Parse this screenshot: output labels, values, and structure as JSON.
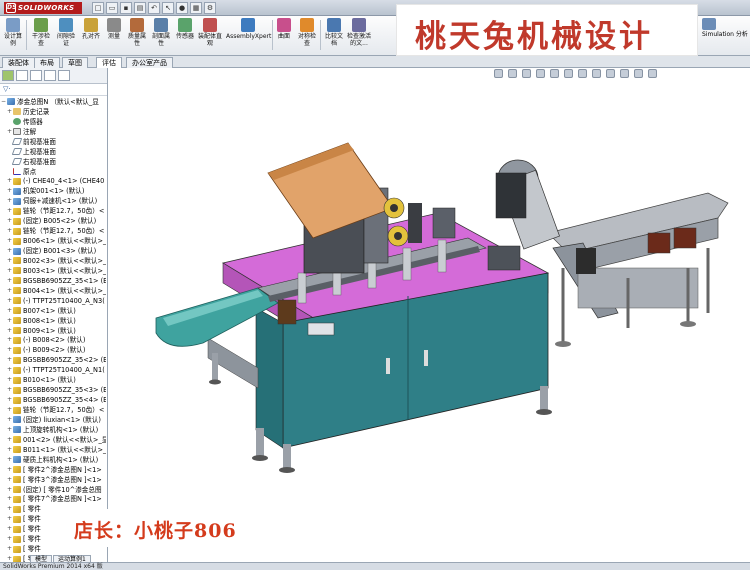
{
  "app": {
    "logo_text": "SOLIDWORKS",
    "status_text": "SolidWorks Premium 2014 x64 版"
  },
  "ribbon": {
    "buttons": [
      {
        "label": "设计算例",
        "color": "#7a9cc6"
      },
      {
        "label": "干涉检查",
        "color": "#6b9e4b"
      },
      {
        "label": "间隙验证",
        "color": "#4e8fbf"
      },
      {
        "label": "孔对齐",
        "color": "#c9a23a"
      },
      {
        "label": "测量",
        "color": "#8a8a8a"
      },
      {
        "label": "质量属性",
        "color": "#b36a3b"
      },
      {
        "label": "剖面属性",
        "color": "#5a7fa8"
      },
      {
        "label": "传感器",
        "color": "#5aa36b"
      },
      {
        "label": "装配体直观",
        "color": "#c05050"
      },
      {
        "label": "AssemblyXpert",
        "color": "#3d7bbf"
      },
      {
        "label": "曲面",
        "color": "#c84f8c"
      },
      {
        "label": "对称检查",
        "color": "#e08a2b"
      },
      {
        "label": "比较文档",
        "color": "#4a78b0"
      },
      {
        "label": "检查激活的文...",
        "color": "#6b6b9e"
      },
      {
        "label": "Simulation 分析",
        "color": "#6c8db7"
      }
    ]
  },
  "watermarks": {
    "top": "桃天兔机械设计",
    "bottom": "店长：小桃子806"
  },
  "tabs": [
    "装配体",
    "布局",
    "草图",
    "评估",
    "办公室产品"
  ],
  "tree": {
    "filter_icon": "filter-icon",
    "items": [
      {
        "label": "渗金总图N （默认<默认_显",
        "icon": "asm",
        "exp": "−"
      },
      {
        "label": "历史记录",
        "icon": "folder",
        "exp": "+"
      },
      {
        "label": "传感器",
        "icon": "sensor",
        "exp": ""
      },
      {
        "label": "注解",
        "icon": "note",
        "exp": "+"
      },
      {
        "label": "前视基准面",
        "icon": "plane",
        "exp": ""
      },
      {
        "label": "上视基准面",
        "icon": "plane",
        "exp": ""
      },
      {
        "label": "右视基准面",
        "icon": "plane",
        "exp": ""
      },
      {
        "label": "原点",
        "icon": "origin",
        "exp": ""
      },
      {
        "label": "(-) CHE40_4<1> (CHE40",
        "icon": "part",
        "exp": "+"
      },
      {
        "label": "机架001<1> (默认)",
        "icon": "asm",
        "exp": "+"
      },
      {
        "label": "伺服+减速机<1> (默认)",
        "icon": "asm",
        "exp": "+"
      },
      {
        "label": "链轮（节距12.7，50齿）<",
        "icon": "part",
        "exp": "+"
      },
      {
        "label": "(固定) B005<2> (默认)",
        "icon": "part",
        "exp": "+"
      },
      {
        "label": "链轮（节距12.7，50齿）<",
        "icon": "part",
        "exp": "+"
      },
      {
        "label": "B006<1> (默认<<默认>_",
        "icon": "part",
        "exp": "+"
      },
      {
        "label": "(固定) B001<3> (默认)",
        "icon": "asm",
        "exp": "+"
      },
      {
        "label": "B002<3> (默认<<默认>_",
        "icon": "part",
        "exp": "+"
      },
      {
        "label": "B003<1> (默认<<默认>_",
        "icon": "part",
        "exp": "+"
      },
      {
        "label": "BGSBB6905ZZ_35<1> (E",
        "icon": "part",
        "exp": "+"
      },
      {
        "label": "B004<1> (默认<<默认>_",
        "icon": "part",
        "exp": "+"
      },
      {
        "label": "(-) TTPT25T10400_A_N3(",
        "icon": "part",
        "exp": "+"
      },
      {
        "label": "B007<1> (默认)",
        "icon": "part",
        "exp": "+"
      },
      {
        "label": "B008<1> (默认)",
        "icon": "part",
        "exp": "+"
      },
      {
        "label": "B009<1> (默认)",
        "icon": "part",
        "exp": "+"
      },
      {
        "label": "(-) B008<2> (默认)",
        "icon": "part",
        "exp": "+"
      },
      {
        "label": "(-) B009<2> (默认)",
        "icon": "part",
        "exp": "+"
      },
      {
        "label": "BGSBB6905ZZ_35<2> (E",
        "icon": "part",
        "exp": "+"
      },
      {
        "label": "(-) TTPT25T10400_A_N1(",
        "icon": "part",
        "exp": "+"
      },
      {
        "label": "B010<1> (默认)",
        "icon": "part",
        "exp": "+"
      },
      {
        "label": "BGSBB6905ZZ_35<3> (E",
        "icon": "part",
        "exp": "+"
      },
      {
        "label": "BGSBB6905ZZ_35<4> (E",
        "icon": "part",
        "exp": "+"
      },
      {
        "label": "链轮（节距12.7，50齿）<",
        "icon": "part",
        "exp": "+"
      },
      {
        "label": "(固定) liuxian<1> (默认)",
        "icon": "asm",
        "exp": "+"
      },
      {
        "label": "上顶旋转机构<1> (默认)",
        "icon": "asm",
        "exp": "+"
      },
      {
        "label": "001<2> (默认<<默认>_显",
        "icon": "part",
        "exp": "+"
      },
      {
        "label": "B011<1> (默认<<默认>_",
        "icon": "part",
        "exp": "+"
      },
      {
        "label": "硬质上料机构<1> (默认)",
        "icon": "asm",
        "exp": "+"
      },
      {
        "label": "[ 零件2^渗金总图N ]<1>",
        "icon": "part",
        "exp": "+"
      },
      {
        "label": "[ 零件3^渗金总图N ]<1>",
        "icon": "part",
        "exp": "+"
      },
      {
        "label": "(固定) [ 零件10^渗金总图",
        "icon": "part",
        "exp": "+"
      },
      {
        "label": "[ 零件7^渗金总图N ]<1>",
        "icon": "part",
        "exp": "+"
      },
      {
        "label": "[ 零件",
        "icon": "part",
        "exp": "+"
      },
      {
        "label": "[ 零件",
        "icon": "part",
        "exp": "+"
      },
      {
        "label": "[ 零件",
        "icon": "part",
        "exp": "+"
      },
      {
        "label": "[ 零件",
        "icon": "part",
        "exp": "+"
      },
      {
        "label": "[ 零件",
        "icon": "part",
        "exp": "+"
      },
      {
        "label": "[ 零件",
        "icon": "part",
        "exp": "+"
      },
      {
        "label": "[ 零件",
        "icon": "part",
        "exp": "+"
      }
    ],
    "bottom_tabs": [
      "模型",
      "运动算例1"
    ]
  }
}
